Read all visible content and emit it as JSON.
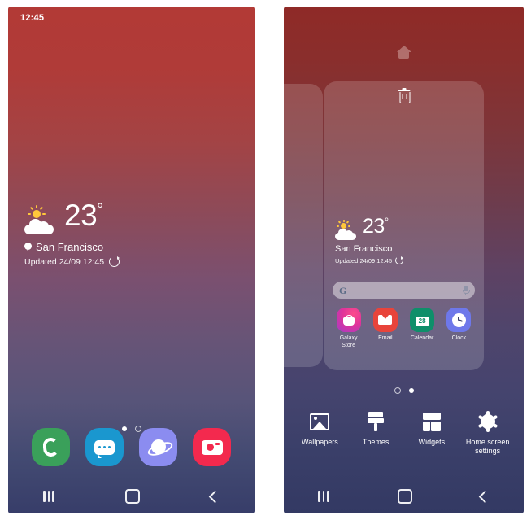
{
  "left_phone": {
    "status": {
      "time": "12:45"
    },
    "weather": {
      "temperature": "23",
      "degree": "°",
      "location": "San Francisco",
      "updated": "Updated 24/09 12:45",
      "icon": "partly-cloudy-icon",
      "location_icon": "location-pin-icon",
      "refresh_icon": "refresh-icon"
    },
    "page_dots": {
      "count": 2,
      "active_index": 0
    },
    "dock": [
      {
        "name": "phone",
        "label": "Phone",
        "icon": "phone-icon",
        "color": "#3aa05a"
      },
      {
        "name": "messages",
        "label": "Messages",
        "icon": "message-bubble-icon",
        "color": "#1a97cf"
      },
      {
        "name": "internet",
        "label": "Internet",
        "icon": "internet-planet-icon",
        "color": "#8b8cf0"
      },
      {
        "name": "camera",
        "label": "Camera",
        "icon": "camera-icon",
        "color": "#f3294e"
      }
    ],
    "navbar": [
      {
        "name": "recents",
        "label": "Recents",
        "icon": "recents-icon"
      },
      {
        "name": "home",
        "label": "Home",
        "icon": "home-square-icon"
      },
      {
        "name": "back",
        "label": "Back",
        "icon": "back-chevron-icon"
      }
    ]
  },
  "right_phone": {
    "edit_mode": true,
    "home_indicator_icon": "home-icon",
    "page_card": {
      "remove_icon": "trash-icon",
      "weather": {
        "temperature": "23",
        "degree": "°",
        "location": "San Francisco",
        "updated": "Updated 24/09 12:45",
        "icon": "partly-cloudy-icon",
        "refresh_icon": "refresh-icon"
      },
      "search": {
        "logo": "G",
        "logo_icon": "google-g-icon",
        "mic_icon": "microphone-icon",
        "placeholder": ""
      },
      "apps": [
        {
          "label": "Galaxy\nStore",
          "label_line1": "Galaxy",
          "label_line2": "Store",
          "icon": "shopping-bag-icon",
          "color": "#e0339a"
        },
        {
          "label": "Email",
          "label_line1": "Email",
          "label_line2": "",
          "icon": "envelope-icon",
          "color": "#e8443b"
        },
        {
          "label": "Calendar",
          "label_line1": "Calendar",
          "label_line2": "",
          "icon": "calendar-icon",
          "day": "28",
          "color": "#0e8f6a"
        },
        {
          "label": "Clock",
          "label_line1": "Clock",
          "label_line2": "",
          "icon": "clock-icon",
          "color": "#6e78ea"
        }
      ]
    },
    "page_dots": {
      "count": 2,
      "active_index": 1
    },
    "toolbar": [
      {
        "label": "Wallpapers",
        "icon": "image-icon"
      },
      {
        "label": "Themes",
        "icon": "paintbrush-icon"
      },
      {
        "label": "Widgets",
        "icon": "widgets-grid-icon"
      },
      {
        "label": "Home screen settings",
        "label_line1": "Home screen",
        "label_line2": "settings",
        "icon": "gear-icon"
      }
    ],
    "navbar": [
      {
        "name": "recents",
        "label": "Recents",
        "icon": "recents-icon"
      },
      {
        "name": "home",
        "label": "Home",
        "icon": "home-square-icon"
      },
      {
        "name": "back",
        "label": "Back",
        "icon": "back-chevron-icon"
      }
    ]
  },
  "theme": {
    "gradient_top": "#b23a36",
    "gradient_mid": "#6a5277",
    "gradient_bottom": "#373d69"
  }
}
